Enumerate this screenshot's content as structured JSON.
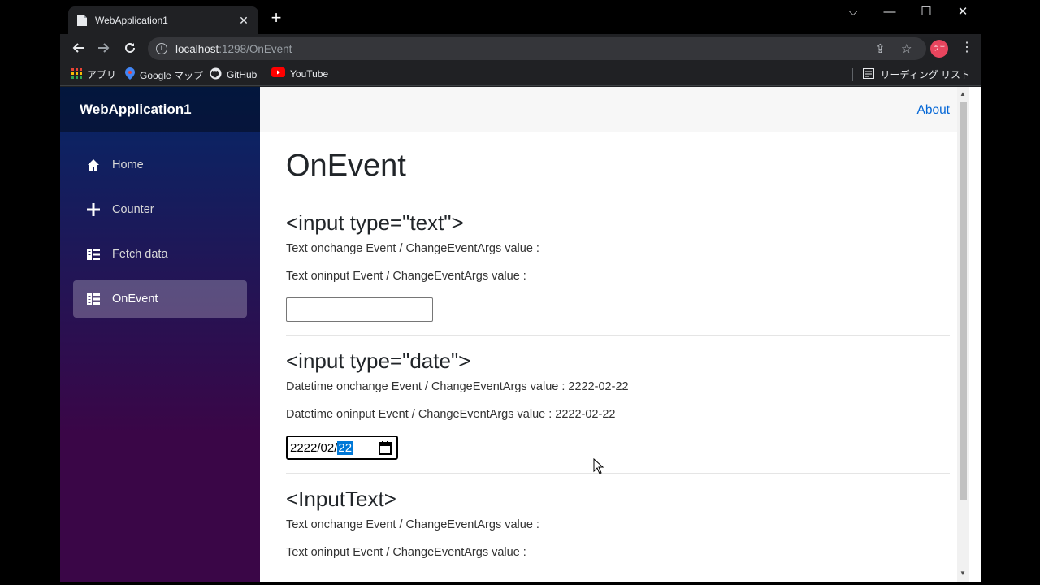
{
  "browser": {
    "tab_title": "WebApplication1",
    "url_host": "localhost",
    "url_path": ":1298/OnEvent",
    "avatar_text": "ウニ",
    "bookmarks": [
      {
        "label": "アプリ",
        "icon": "apps-grid-icon"
      },
      {
        "label": "Google マップ",
        "icon": "maps-pin-icon"
      },
      {
        "label": "GitHub",
        "icon": "github-icon"
      },
      {
        "label": "YouTube",
        "icon": "youtube-icon"
      }
    ],
    "reading_list": "リーディング リスト"
  },
  "app": {
    "brand": "WebApplication1",
    "about": "About",
    "nav": [
      {
        "label": "Home",
        "icon": "home-icon"
      },
      {
        "label": "Counter",
        "icon": "plus-icon"
      },
      {
        "label": "Fetch data",
        "icon": "list-icon"
      },
      {
        "label": "OnEvent",
        "icon": "list-icon",
        "active": true
      }
    ]
  },
  "content": {
    "title": "OnEvent",
    "section_text": {
      "heading": "<input type=\"text\">",
      "onchange": "Text onchange Event / ChangeEventArgs value :",
      "oninput": "Text oninput Event / ChangeEventArgs value :",
      "input_value": ""
    },
    "section_date": {
      "heading": "<input type=\"date\">",
      "onchange": "Datetime onchange Event / ChangeEventArgs value : 2222-02-22",
      "oninput": "Datetime oninput Event / ChangeEventArgs value : 2222-02-22",
      "date_prefix": "2222/02/",
      "date_selected": "22"
    },
    "section_inputtext": {
      "heading": "<InputText>",
      "onchange": "Text onchange Event / ChangeEventArgs value :",
      "oninput": "Text oninput Event / ChangeEventArgs value :"
    }
  },
  "colors": {
    "link": "#0366d6",
    "sidebar_top": "#052767",
    "sidebar_bottom": "#3a0647"
  }
}
